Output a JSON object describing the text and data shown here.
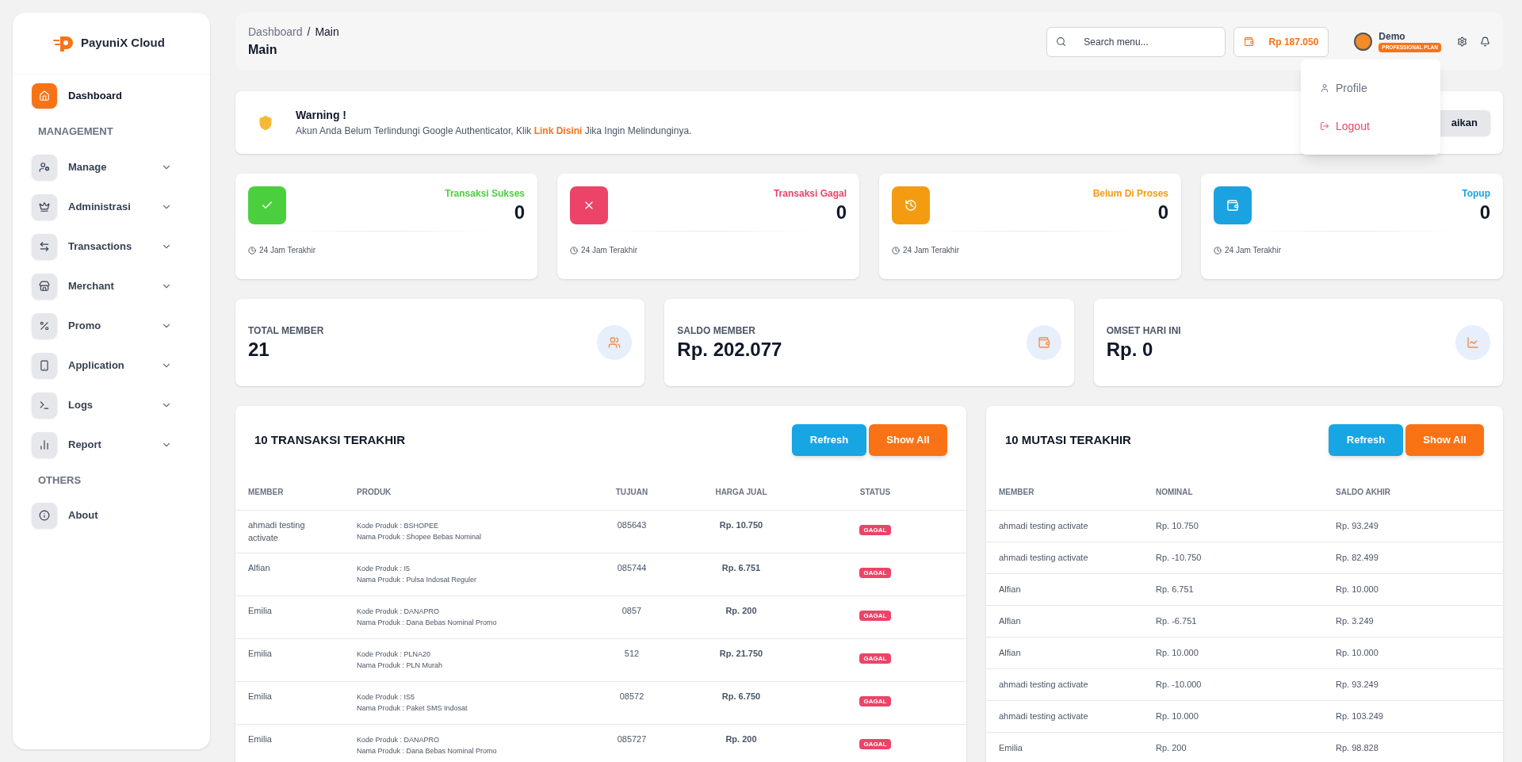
{
  "sidebar": {
    "brand": "PayuniX Cloud",
    "sections": [
      {
        "items": [
          {
            "label": "Dashboard",
            "selected": true,
            "has_submenu": false
          }
        ]
      },
      {
        "heading": "MANAGEMENT",
        "items": [
          {
            "label": "Manage",
            "selected": false,
            "has_submenu": true
          },
          {
            "label": "Administrasi",
            "selected": false,
            "has_submenu": true
          },
          {
            "label": "Transactions",
            "selected": false,
            "has_submenu": true
          },
          {
            "label": "Merchant",
            "selected": false,
            "has_submenu": true
          },
          {
            "label": "Promo",
            "selected": false,
            "has_submenu": true
          },
          {
            "label": "Application",
            "selected": false,
            "has_submenu": true
          },
          {
            "label": "Logs",
            "selected": false,
            "has_submenu": true
          },
          {
            "label": "Report",
            "selected": false,
            "has_submenu": true
          }
        ]
      },
      {
        "heading": "OTHERS",
        "items": [
          {
            "label": "About",
            "selected": false,
            "has_submenu": false
          }
        ]
      }
    ]
  },
  "header": {
    "breadcrumb": [
      "Dashboard",
      "Main"
    ],
    "separator": "/",
    "title": "Main",
    "search": {
      "placeholder": "Search menu..."
    },
    "balance": "Rp 187.050",
    "user": {
      "name": "Demo",
      "plan": "PROFESSIONAL PLAN"
    },
    "user_menu": {
      "expanded": true,
      "items": [
        "Profile",
        "Logout"
      ]
    }
  },
  "warning": {
    "title": "Warning !",
    "text_before": "Akun Anda Belum Terlindungi Google Authenticator, Klik",
    "link": "Link Disini",
    "text_after": "Jika Ingin Melindunginya.",
    "button": "aikan"
  },
  "stat_cards": [
    {
      "label": "Transaksi Sukses",
      "value": "0",
      "footer": "24 Jam Terakhir",
      "color": "#4ccf3f"
    },
    {
      "label": "Transaksi Gagal",
      "value": "0",
      "footer": "24 Jam Terakhir",
      "color": "#ec4468"
    },
    {
      "label": "Belum Di Proses",
      "value": "0",
      "footer": "24 Jam Terakhir",
      "color": "#f39c12"
    },
    {
      "label": "Topup",
      "value": "0",
      "footer": "24 Jam Terakhir",
      "color": "#1aa3e0"
    }
  ],
  "summary_cards": [
    {
      "label": "TOTAL MEMBER",
      "value": "21"
    },
    {
      "label": "SALDO MEMBER",
      "value": "Rp. 202.077"
    },
    {
      "label": "OMSET HARI INI",
      "value": "Rp. 0"
    }
  ],
  "transactions": {
    "title": "10 TRANSAKSI TERAKHIR",
    "buttons": [
      "Refresh",
      "Show All"
    ],
    "columns": [
      "MEMBER",
      "PRODUK",
      "TUJUAN",
      "HARGA JUAL",
      "STATUS"
    ],
    "rows": [
      {
        "member": "ahmadi testing activate",
        "product_code": "Kode Produk : BSHOPEE",
        "product_name": "Nama Produk : Shopee Bebas Nominal",
        "destination": "085643",
        "price": "Rp. 10.750",
        "status": "GAGAL"
      },
      {
        "member": "Alfian",
        "product_code": "Kode Produk : I5",
        "product_name": "Nama Produk : Pulsa Indosat Reguler",
        "destination": "085744",
        "price": "Rp. 6.751",
        "status": "GAGAL"
      },
      {
        "member": "Emilia",
        "product_code": "Kode Produk : DANAPRO",
        "product_name": "Nama Produk : Dana Bebas Nominal Promo",
        "destination": "0857",
        "price": "Rp. 200",
        "status": "GAGAL"
      },
      {
        "member": "Emilia",
        "product_code": "Kode Produk : PLNA20",
        "product_name": "Nama Produk : PLN Murah",
        "destination": "512",
        "price": "Rp. 21.750",
        "status": "GAGAL"
      },
      {
        "member": "Emilia",
        "product_code": "Kode Produk : IS5",
        "product_name": "Nama Produk : Paket SMS Indosat",
        "destination": "08572",
        "price": "Rp. 6.750",
        "status": "GAGAL"
      },
      {
        "member": "Emilia",
        "product_code": "Kode Produk : DANAPRO",
        "product_name": "Nama Produk : Dana Bebas Nominal Promo",
        "destination": "085727",
        "price": "Rp. 200",
        "status": "GAGAL"
      }
    ]
  },
  "mutations": {
    "title": "10 MUTASI TERAKHIR",
    "buttons": [
      "Refresh",
      "Show All"
    ],
    "columns": [
      "MEMBER",
      "NOMINAL",
      "SALDO AKHIR"
    ],
    "rows": [
      {
        "member": "ahmadi testing activate",
        "nominal": "Rp. 10.750",
        "balance": "Rp. 93.249"
      },
      {
        "member": "ahmadi testing activate",
        "nominal": "Rp. -10.750",
        "balance": "Rp. 82.499"
      },
      {
        "member": "Alfian",
        "nominal": "Rp. 6.751",
        "balance": "Rp. 10.000"
      },
      {
        "member": "Alfian",
        "nominal": "Rp. -6.751",
        "balance": "Rp. 3.249"
      },
      {
        "member": "Alfian",
        "nominal": "Rp. 10.000",
        "balance": "Rp. 10.000"
      },
      {
        "member": "ahmadi testing activate",
        "nominal": "Rp. -10.000",
        "balance": "Rp. 93.249"
      },
      {
        "member": "ahmadi testing activate",
        "nominal": "Rp. 10.000",
        "balance": "Rp. 103.249"
      },
      {
        "member": "Emilia",
        "nominal": "Rp. 200",
        "balance": "Rp. 98.828"
      }
    ]
  }
}
